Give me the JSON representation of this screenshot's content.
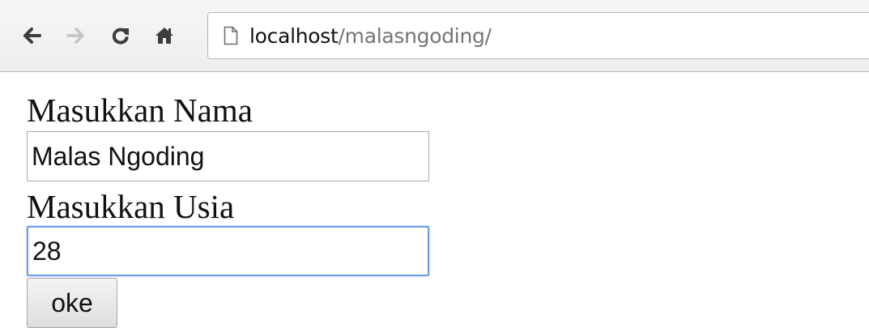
{
  "browser": {
    "url_host": "localhost",
    "url_path": "/malasngoding/",
    "icons": {
      "back": "arrow-left-icon",
      "forward": "arrow-right-icon",
      "reload": "reload-icon",
      "home": "home-icon",
      "page": "page-icon"
    }
  },
  "form": {
    "nama_label": "Masukkan Nama",
    "nama_value": "Malas Ngoding",
    "usia_label": "Masukkan Usia",
    "usia_value": "28",
    "submit_label": "oke"
  },
  "colors": {
    "focus_border": "#6d9de6",
    "url_path": "#757575",
    "toolbar_bg": "#f2f2f2"
  }
}
